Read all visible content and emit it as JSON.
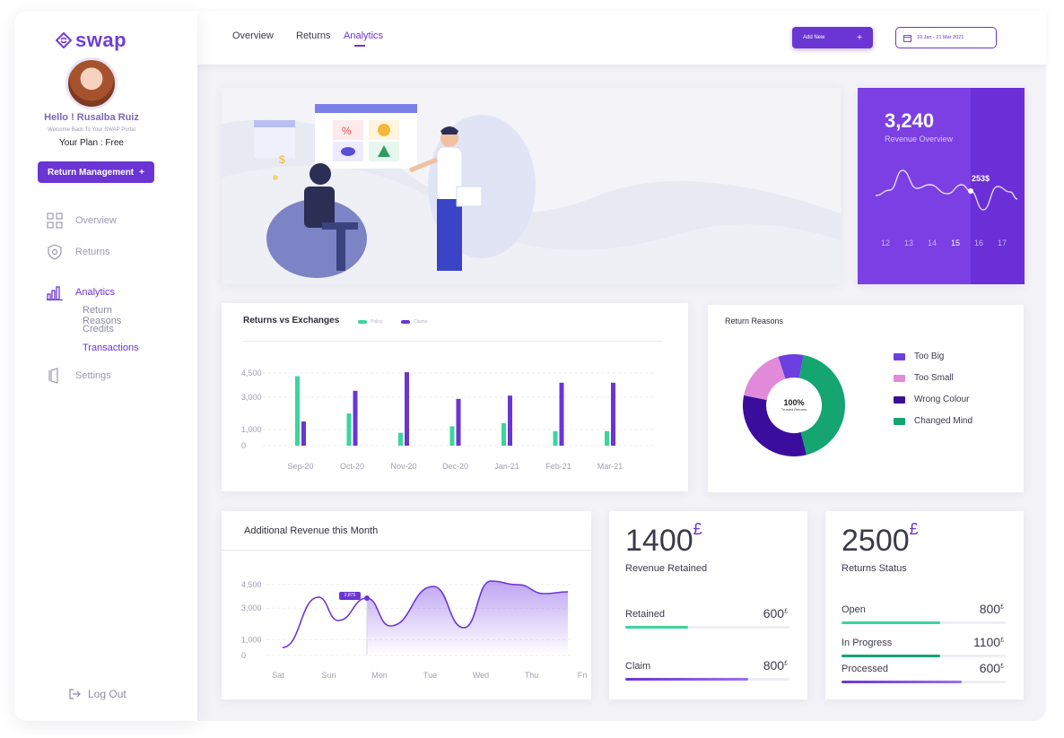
{
  "brand": {
    "name": "swap"
  },
  "user": {
    "greeting": "Hello ! Rusalba Ruiz",
    "welcome": "Welcome Back To Your SWAP Portal",
    "plan": "Your Plan : Free"
  },
  "sidebar": {
    "cta_label": "Return Management",
    "cta_icon": "+",
    "items": [
      {
        "label": "Overview",
        "icon": "grid-icon"
      },
      {
        "label": "Returns",
        "icon": "shield-icon"
      },
      {
        "label": "Analytics",
        "icon": "bar-chart-icon"
      },
      {
        "label": "Settings",
        "icon": "settings-icon"
      }
    ],
    "analytics_sub": [
      "Return Reasons",
      "Credits",
      "Transactions"
    ],
    "logout": "Log Out"
  },
  "topbar": {
    "tabs": [
      "Overview",
      "Returns",
      "Analytics"
    ],
    "active_tab": "Analytics",
    "add_label": "Add New",
    "add_icon": "+",
    "date_range": "10 Jan - 21 Mar 2021"
  },
  "revenue_card": {
    "value": "3,240",
    "label": "Revenue Overview",
    "point_label": "253$",
    "days": [
      "12",
      "13",
      "14",
      "15",
      "16",
      "17"
    ],
    "selected_day": "15"
  },
  "returns_exchanges": {
    "title": "Returns vs Exchanges",
    "legend": [
      "Policy",
      "Claims"
    ],
    "y_ticks": [
      "4,500",
      "3,000",
      "1,000",
      "0"
    ],
    "colors": {
      "policy": "#3bd59d",
      "claims": "#6b35d4"
    }
  },
  "return_reasons": {
    "title": "Return Reasons",
    "center_value": "100%",
    "center_label": "Trusted Returns",
    "legend": [
      {
        "label": "Too Big",
        "color": "#6b3fe0"
      },
      {
        "label": "Too Small",
        "color": "#e18ad9"
      },
      {
        "label": "Wrong Colour",
        "color": "#3a0d9c"
      },
      {
        "label": "Changed Mind",
        "color": "#14a571"
      }
    ]
  },
  "additional_revenue": {
    "title": "Additional Revenue this Month",
    "y_ticks": [
      "4,500",
      "3,000",
      "1,000",
      "0"
    ],
    "tooltip": "2,875"
  },
  "retained": {
    "value": "1400",
    "currency": "£",
    "label": "Revenue Retained",
    "rows": [
      {
        "label": "Retained",
        "value": "600",
        "currency": "£"
      },
      {
        "label": "Claim",
        "value": "800",
        "currency": "£"
      }
    ]
  },
  "returns_status": {
    "value": "2500",
    "currency": "£",
    "label": "Returns Status",
    "rows": [
      {
        "label": "Open",
        "value": "800",
        "currency": "£"
      },
      {
        "label": "In Progress",
        "value": "1100",
        "currency": "£"
      },
      {
        "label": "Processed",
        "value": "600",
        "currency": "£"
      }
    ]
  },
  "chart_data": [
    {
      "type": "bar",
      "title": "Returns vs Exchanges",
      "categories": [
        "Sep-20",
        "Oct-20",
        "Nov-20",
        "Dec-20",
        "Jan-21",
        "Feb-21",
        "Mar-21"
      ],
      "series": [
        {
          "name": "Policy",
          "values": [
            4300,
            2000,
            800,
            1200,
            1400,
            900,
            900
          ]
        },
        {
          "name": "Claims",
          "values": [
            1500,
            3400,
            4550,
            2900,
            3100,
            3900,
            3900
          ]
        }
      ],
      "ylim": [
        0,
        5000
      ],
      "yticks": [
        0,
        1000,
        3000,
        4500
      ],
      "grid": true
    },
    {
      "type": "pie",
      "title": "Return Reasons",
      "labels": [
        "Too Big",
        "Too Small",
        "Wrong Colour",
        "Changed Mind"
      ],
      "values": [
        8,
        17,
        32,
        43
      ]
    },
    {
      "type": "area",
      "title": "Additional Revenue this Month",
      "categories": [
        "Sat",
        "Sun",
        "Mon",
        "Tue",
        "Wed",
        "Thu",
        "Fri"
      ],
      "values": [
        500,
        2875,
        2875,
        4000,
        4300,
        4100,
        4300
      ],
      "ylim": [
        0,
        5000
      ],
      "yticks": [
        0,
        1000,
        3000,
        4500
      ],
      "grid": true
    },
    {
      "type": "line",
      "title": "Revenue Overview",
      "categories": [
        "12",
        "13",
        "14",
        "15",
        "16",
        "17"
      ],
      "values": [
        220,
        270,
        240,
        253,
        200,
        245
      ]
    }
  ]
}
